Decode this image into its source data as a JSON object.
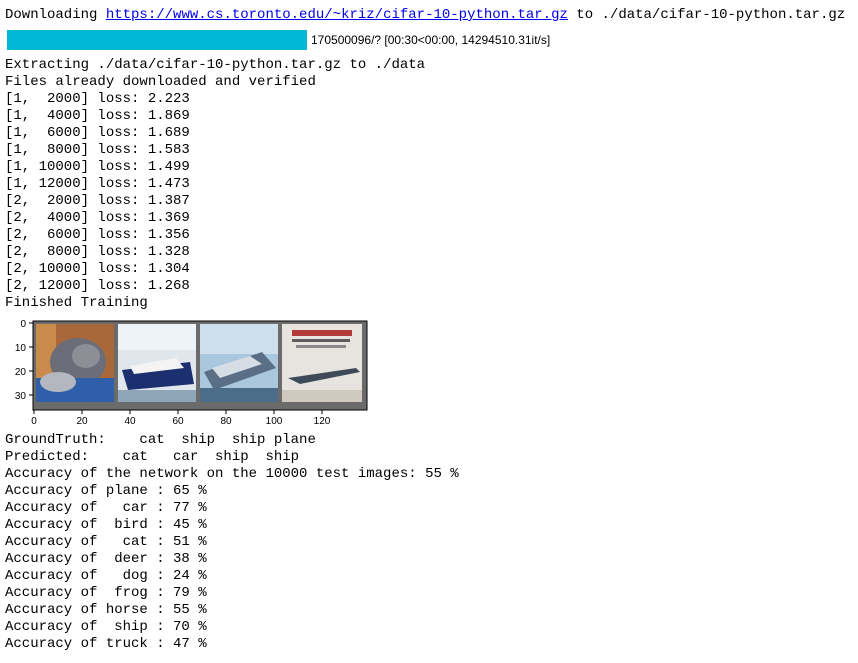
{
  "download": {
    "prefix": "Downloading ",
    "url": "https://www.cs.toronto.edu/~kriz/cifar-10-python.tar.gz",
    "suffix": " to ./data/cifar-10-python.tar.gz"
  },
  "progress": {
    "fraction": 1.0,
    "text": "170500096/? [00:30<00:00, 14294510.31it/s]",
    "color": "#00b8d4"
  },
  "log_lines": [
    "Extracting ./data/cifar-10-python.tar.gz to ./data",
    "Files already downloaded and verified",
    "[1,  2000] loss: 2.223",
    "[1,  4000] loss: 1.869",
    "[1,  6000] loss: 1.689",
    "[1,  8000] loss: 1.583",
    "[1, 10000] loss: 1.499",
    "[1, 12000] loss: 1.473",
    "[2,  2000] loss: 1.387",
    "[2,  4000] loss: 1.369",
    "[2,  6000] loss: 1.356",
    "[2,  8000] loss: 1.328",
    "[2, 10000] loss: 1.304",
    "[2, 12000] loss: 1.268",
    "Finished Training"
  ],
  "image_grid": {
    "x_ticks": [
      "0",
      "20",
      "40",
      "60",
      "80",
      "100",
      "120"
    ],
    "y_ticks": [
      "0",
      "10",
      "20",
      "30"
    ],
    "images": [
      {
        "name": "cat-image"
      },
      {
        "name": "ship-image-1"
      },
      {
        "name": "ship-image-2"
      },
      {
        "name": "plane-image"
      }
    ]
  },
  "result_lines": [
    "GroundTruth:    cat  ship  ship plane",
    "Predicted:    cat   car  ship  ship",
    "Accuracy of the network on the 10000 test images: 55 %",
    "Accuracy of plane : 65 %",
    "Accuracy of   car : 77 %",
    "Accuracy of  bird : 45 %",
    "Accuracy of   cat : 51 %",
    "Accuracy of  deer : 38 %",
    "Accuracy of   dog : 24 %",
    "Accuracy of  frog : 79 %",
    "Accuracy of horse : 55 %",
    "Accuracy of  ship : 70 %",
    "Accuracy of truck : 47 %"
  ]
}
